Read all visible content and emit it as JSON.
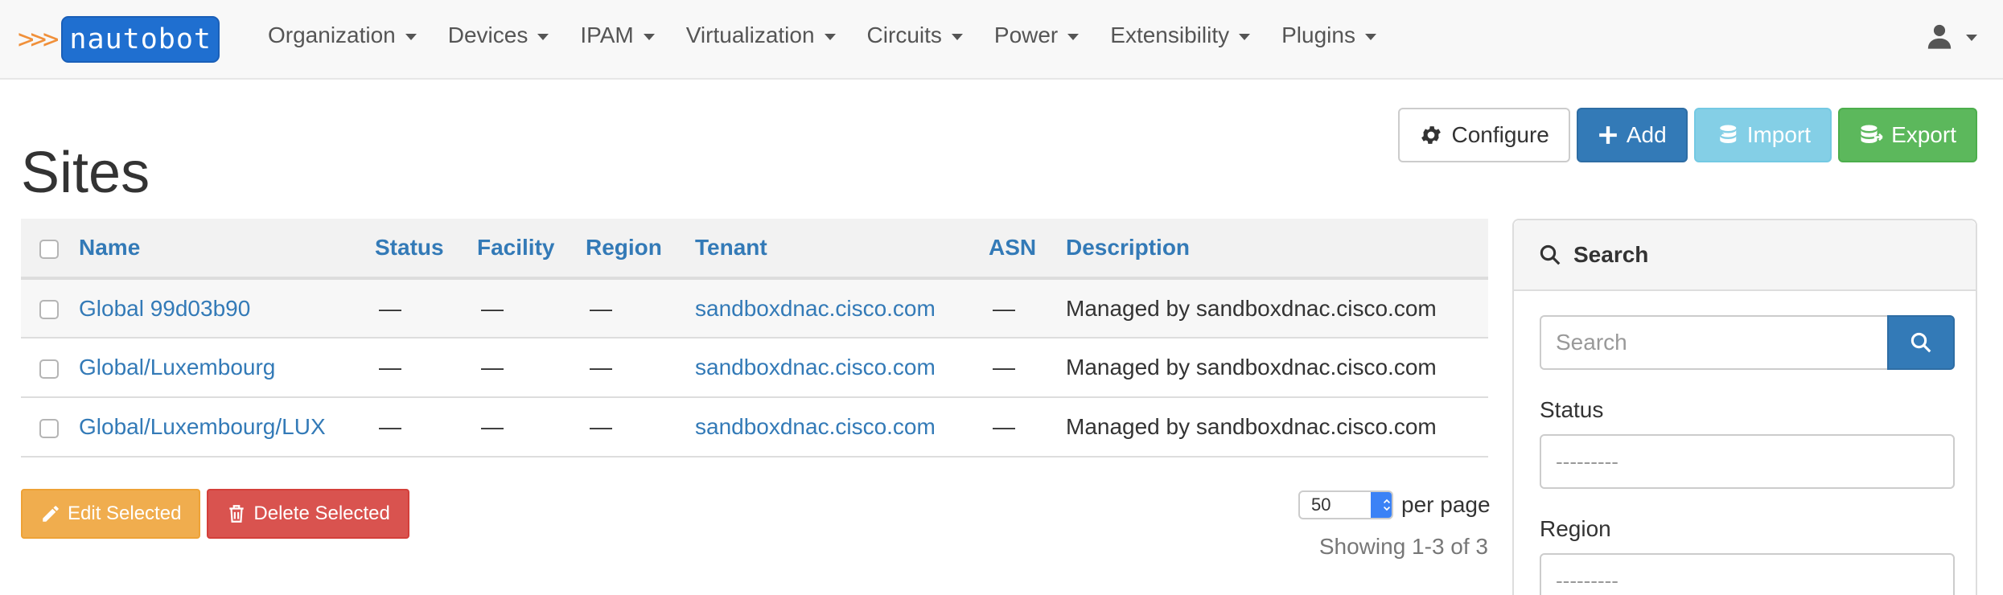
{
  "brand": {
    "chevrons": ">>>",
    "name": "nautobot"
  },
  "nav": {
    "items": [
      {
        "label": "Organization"
      },
      {
        "label": "Devices"
      },
      {
        "label": "IPAM"
      },
      {
        "label": "Virtualization"
      },
      {
        "label": "Circuits"
      },
      {
        "label": "Power"
      },
      {
        "label": "Extensibility"
      },
      {
        "label": "Plugins"
      }
    ],
    "user_icon": "user-icon"
  },
  "page": {
    "title": "Sites"
  },
  "actions": {
    "configure": "Configure",
    "add": "Add",
    "import": "Import",
    "export": "Export"
  },
  "table": {
    "columns": [
      "Name",
      "Status",
      "Facility",
      "Region",
      "Tenant",
      "ASN",
      "Description"
    ],
    "rows": [
      {
        "name": "Global 99d03b90",
        "status": "—",
        "facility": "—",
        "region": "—",
        "tenant": "sandboxdnac.cisco.com",
        "asn": "—",
        "description": "Managed by sandboxdnac.cisco.com"
      },
      {
        "name": "Global/Luxembourg",
        "status": "—",
        "facility": "—",
        "region": "—",
        "tenant": "sandboxdnac.cisco.com",
        "asn": "—",
        "description": "Managed by sandboxdnac.cisco.com"
      },
      {
        "name": "Global/Luxembourg/LUX",
        "status": "—",
        "facility": "—",
        "region": "—",
        "tenant": "sandboxdnac.cisco.com",
        "asn": "—",
        "description": "Managed by sandboxdnac.cisco.com"
      }
    ]
  },
  "bulk": {
    "edit": "Edit Selected",
    "delete": "Delete Selected"
  },
  "pagination": {
    "per_page_value": "50",
    "per_page_label": "per page",
    "showing": "Showing 1-3 of 3"
  },
  "search_panel": {
    "title": "Search",
    "search_placeholder": "Search",
    "status_label": "Status",
    "status_value": "---------",
    "region_label": "Region",
    "region_value": "---------"
  },
  "colors": {
    "primary": "#337ab7",
    "info": "#5bc0de",
    "success": "#5cb85c",
    "warning": "#f0ad4e",
    "danger": "#d9534f",
    "brand": "#1f6fd0",
    "brand_chevrons": "#f0903a"
  }
}
